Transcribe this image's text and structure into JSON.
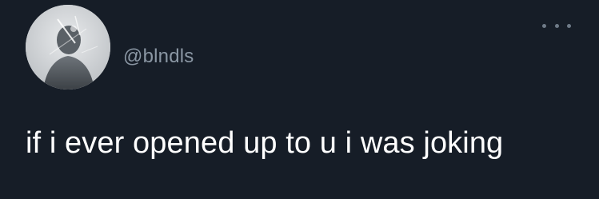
{
  "tweet": {
    "handle": "@blndls",
    "text": "if i ever opened up to u i was joking"
  },
  "icons": {
    "more": "more-options-icon",
    "avatar": "profile-avatar"
  },
  "colors": {
    "background": "#161d27",
    "handle": "#8a96a3",
    "text": "#ffffff"
  }
}
